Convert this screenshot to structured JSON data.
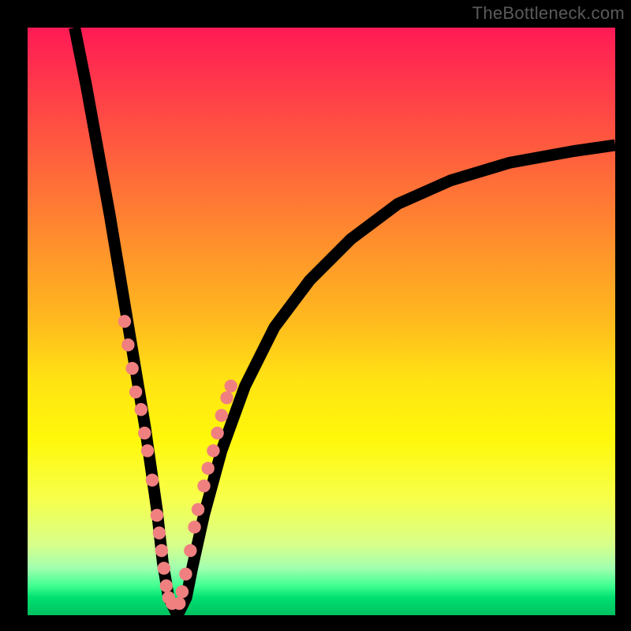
{
  "watermark": "TheBottleneck.com",
  "chart_data": {
    "type": "line",
    "title": "",
    "xlabel": "",
    "ylabel": "",
    "xlim": [
      0,
      100
    ],
    "ylim": [
      0,
      100
    ],
    "curve": {
      "x": [
        8,
        10,
        12,
        14,
        16,
        18,
        19,
        20,
        21,
        22,
        23,
        24,
        25,
        26,
        27,
        28,
        30,
        33,
        37,
        42,
        48,
        55,
        63,
        72,
        82,
        93,
        100
      ],
      "y": [
        100,
        90,
        79,
        68,
        56,
        44,
        38,
        32,
        25,
        18,
        9,
        3,
        1,
        1,
        3,
        8,
        17,
        28,
        39,
        49,
        57,
        64,
        70,
        74,
        77,
        79,
        80
      ]
    },
    "dots_left": {
      "x": [
        16.5,
        17.1,
        17.8,
        18.4,
        19.3,
        19.9,
        20.4,
        21.2,
        22.0,
        22.4,
        22.8,
        23.2,
        23.6,
        24.0,
        24.6
      ],
      "y": [
        50,
        46,
        42,
        38,
        35,
        31,
        28,
        23,
        17,
        14,
        11,
        8,
        5,
        3,
        2
      ]
    },
    "dots_right": {
      "x": [
        25.8,
        26.3,
        26.9,
        27.7,
        28.4,
        29.0,
        30.0,
        30.7,
        31.6,
        32.3,
        33.0,
        33.9,
        34.6
      ],
      "y": [
        2,
        4,
        7,
        11,
        15,
        18,
        22,
        25,
        28,
        31,
        34,
        37,
        39
      ]
    }
  }
}
